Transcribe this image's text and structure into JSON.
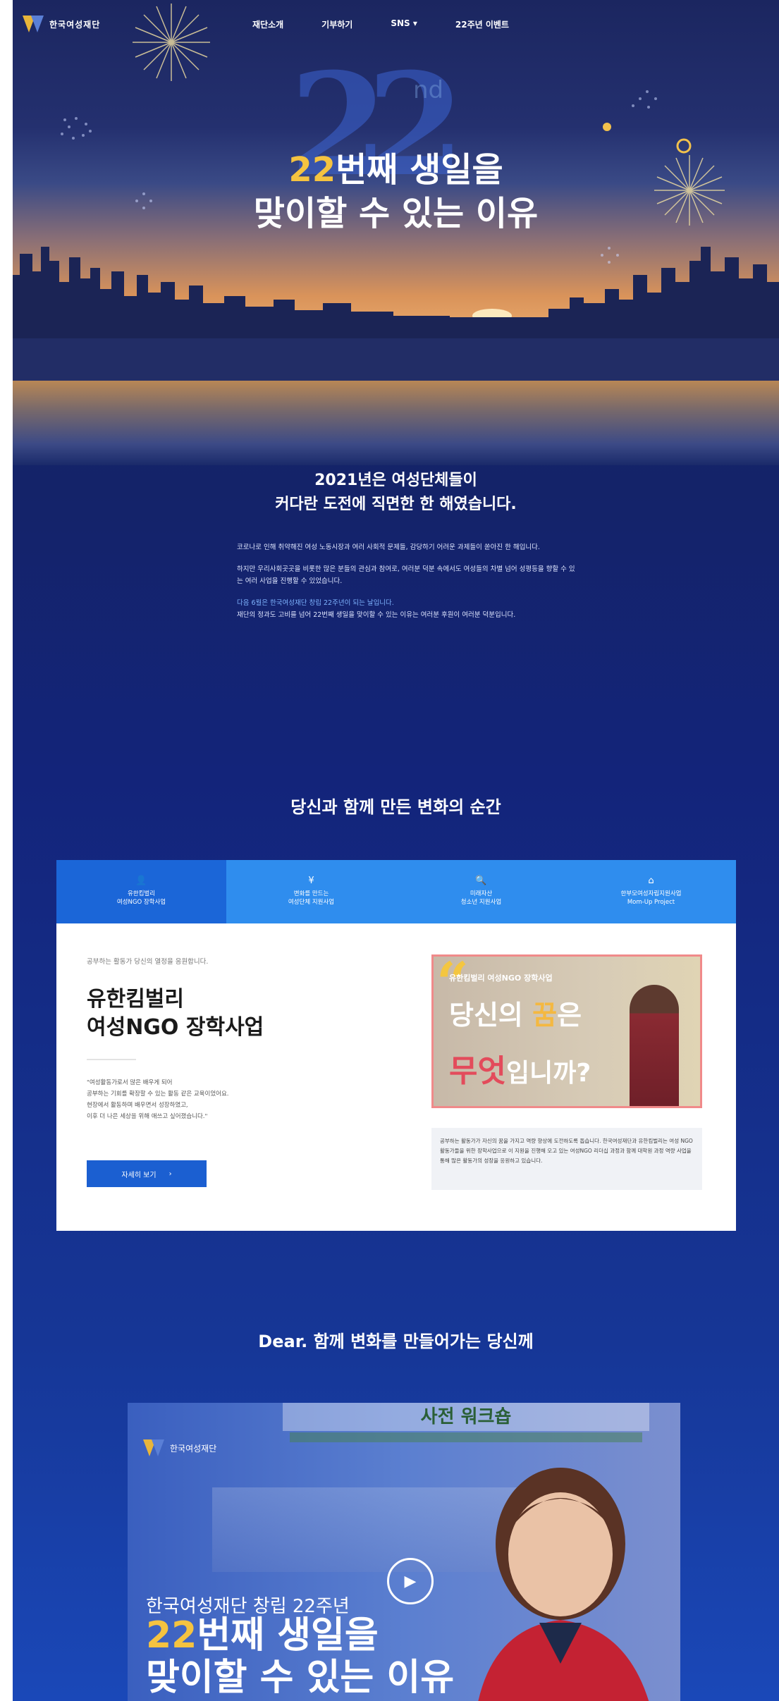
{
  "header": {
    "logo_text": "한국여성재단",
    "menu": [
      "재단소개",
      "기부하기",
      "SNS ▾",
      "22주년 이벤트"
    ]
  },
  "hero": {
    "bg_number": "22",
    "bg_suffix": "nd",
    "title_num": "22",
    "title_line1_rest": "번째 생일을",
    "title_line2_a": "맞이할 수 있는 ",
    "title_line2_b": "이유"
  },
  "intro": {
    "title_line1": "2021년은 여성단체들이",
    "title_line2": "커다란 도전에 직면한 한 해였습니다.",
    "paragraphs": [
      "코로나로 인해 취약해진 여성 노동시장과 여러 사회적 문제들, 감당하기 어려운 과제들이 쏟아진 한 해입니다.",
      "하지만 우리사회곳곳을 비롯한 많은 분들의 관심과 참여로, 여러분 덕분 속에서도 여성들의 차별 넘어 성평등을 향할 수 있는 여러 사업을 진행할 수 있었습니다."
    ],
    "highlight": "다음 6월은 한국여성재단 창립 22주년이 되는 날입니다.",
    "closing": "재단의 정과도 고비를 넘어 22번째 생일을 맞이할 수 있는 이유는 여러분 후원이 여러분 덕분입니다."
  },
  "changes": {
    "title": "당신과 함께 만든 변화의 순간",
    "tabs": [
      {
        "icon": "user-icon",
        "glyph": "👤",
        "line1": "유한킴벌리",
        "line2": "여성NGO 장학사업"
      },
      {
        "icon": "yen-icon",
        "glyph": "¥",
        "line1": "변화를 만드는",
        "line2": "여성단체 지원사업"
      },
      {
        "icon": "search-icon",
        "glyph": "🔍",
        "line1": "미래자산",
        "line2": "청소년 지원사업"
      },
      {
        "icon": "home-icon",
        "glyph": "⌂",
        "line1": "한부모여성자립지원사업",
        "line2": "Mom-Up Project"
      }
    ],
    "active_tab": 0,
    "card": {
      "kicker": "공부하는 활동가 당신의 열정을 응원합니다.",
      "title_line1": "유한킴벌리",
      "title_line2": "여성NGO 장학사업",
      "desc": [
        "\"여성활동가로서 많은 배우게 되어",
        "공부하는 기회를 확장할 수 있는 활동 같은 교육이었어요.",
        "현장에서 활동하며 배우면서 성장하였고,",
        "이후 더 나은 세상을 위해 애쓰고 싶어졌습니다.\""
      ],
      "button_label": "자세히 보기",
      "button_arrow": "›",
      "banner": {
        "quote": "“",
        "kicker": "유한킴벌리 여성NGO 장학사업",
        "line1_a": "당신의 ",
        "line1_b": "꿈",
        "line1_c": "은",
        "line2_a": "무엇",
        "line2_b": "입니까?"
      },
      "note": "공부하는 활동가가 자신의 꿈을 가지고 역량 향상에 도전하도록 돕습니다. 한국여성재단과 유한킴벌리는 여성 NGO 활동가들을 위한 장학사업으로 이 지원을 진행해 오고 있는 여성NGO 리더십 과정과 함께 대학원 과정 역량 사업을 통해 많은 활동가의 성장을 응원하고 있습니다."
    }
  },
  "dear": {
    "title": "Dear. 함께 변화를 만들어가는 당신께"
  },
  "video": {
    "banner_text": "사전 워크숍",
    "logo_text": "한국여성재단",
    "subtitle": "한국여성재단 창립 22주년",
    "title_num": "22",
    "title_line1_rest": "번째 생일을",
    "title_line2": "맞이할 수 있는 이유",
    "play_glyph": "▶"
  },
  "colors": {
    "navy": "#142369",
    "gold": "#f5c340",
    "tab_active": "#1b66d8",
    "tab": "#2f8dee",
    "button": "#1b5fd1"
  }
}
